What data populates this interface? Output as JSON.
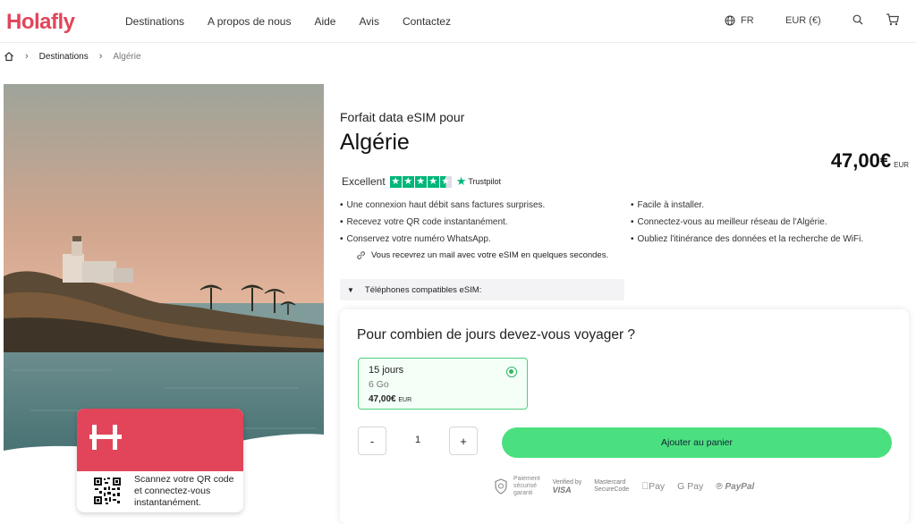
{
  "header": {
    "logo": "Holafly",
    "nav": [
      "Destinations",
      "A propos de nous",
      "Aide",
      "Avis",
      "Contactez"
    ],
    "language": "FR",
    "currency": "EUR (€)"
  },
  "breadcrumb": {
    "items": [
      "Destinations",
      "Algérie"
    ]
  },
  "product": {
    "kicker": "Forfait data eSIM pour",
    "title": "Algérie",
    "price": "47,00€",
    "price_currency": "EUR",
    "rating_label": "Excellent",
    "rating_brand": "Trustpilot",
    "rating_stars": 4.5,
    "features_left": [
      "Une connexion haut débit sans factures surprises.",
      "Recevez votre QR code instantanément.",
      "Conservez votre numéro WhatsApp."
    ],
    "features_right": [
      "Facile à installer.",
      "Connectez-vous au meilleur réseau de l'Algérie.",
      "Oubliez l'itinérance des données et la recherche de WiFi."
    ],
    "mail_note": "Vous recevrez un mail avec votre eSIM en quelques secondes.",
    "compat_label": "Téléphones compatibles eSIM:"
  },
  "card": {
    "text": "Scannez votre QR code et connectez-vous instantanément."
  },
  "purchase": {
    "question": "Pour combien de jours devez-vous voyager ?",
    "plan": {
      "days": "15 jours",
      "data": "6 Go",
      "price": "47,00€",
      "currency": "EUR",
      "selected": true
    },
    "minus": "-",
    "quantity": "1",
    "plus": "+",
    "add_to_cart": "Ajouter au panier"
  },
  "payment": {
    "secure_line1": "Paiement",
    "secure_line2": "sécurisé",
    "secure_line3": "garanti",
    "verified_line1": "Verified by",
    "verified_line2": "VISA",
    "mastercard_line1": "Mastercard",
    "mastercard_line2": "SecureCode",
    "apple_pay": "Pay",
    "google_pay": "Pay",
    "google_g": "G",
    "paypal": "PayPal"
  },
  "colors": {
    "brand": "#e2455a",
    "accent_green": "#4be07f",
    "trustpilot": "#00b67a"
  }
}
